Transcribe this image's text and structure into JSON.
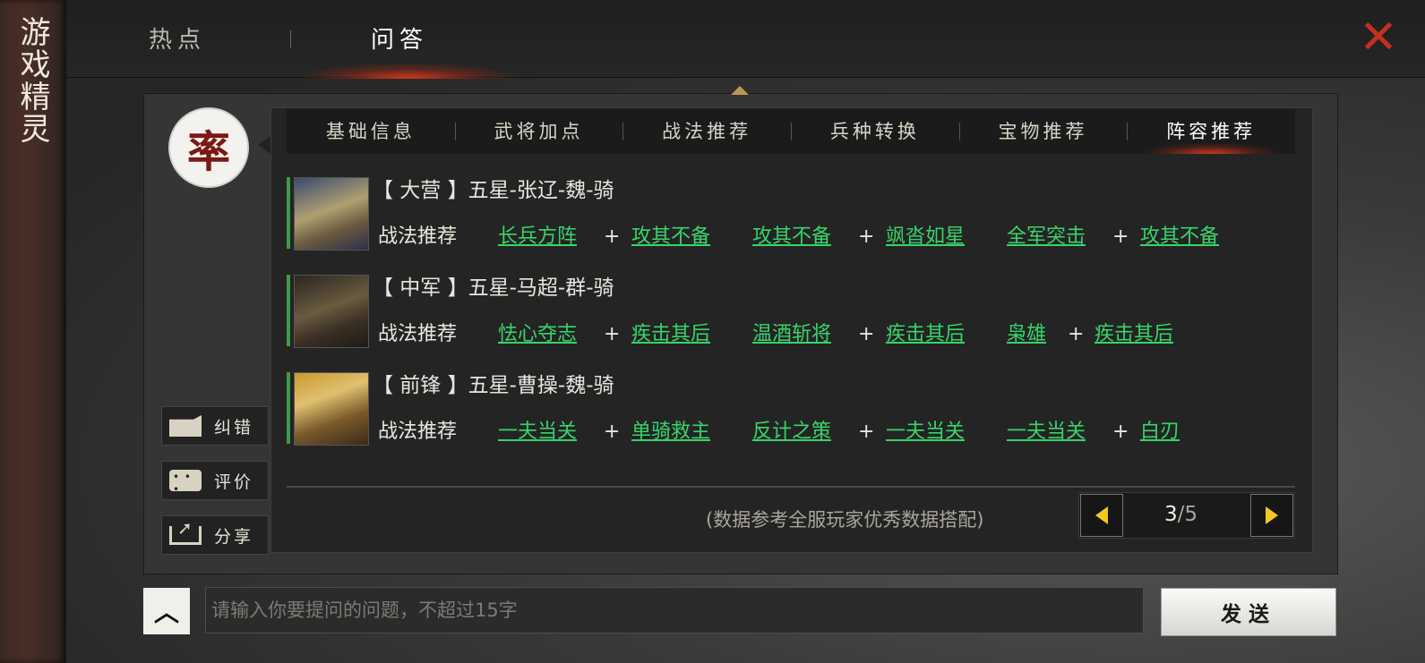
{
  "sidebar_title": "游戏精灵",
  "top_tabs": [
    {
      "label": "热点"
    },
    {
      "label": "问答"
    }
  ],
  "avatar_char": "率",
  "sub_tabs": [
    {
      "label": "基础信息"
    },
    {
      "label": "武将加点"
    },
    {
      "label": "战法推荐"
    },
    {
      "label": "兵种转换"
    },
    {
      "label": "宝物推荐"
    },
    {
      "label": "阵容推荐"
    }
  ],
  "tactic_label": "战法推荐",
  "rows": [
    {
      "role": "【 大营 】五星-张辽-魏-骑",
      "tactics": [
        "长兵方阵",
        "攻其不备",
        "攻其不备",
        "飒沓如星",
        "全军突击",
        "攻其不备"
      ]
    },
    {
      "role": "【 中军 】五星-马超-群-骑",
      "tactics": [
        "怯心夺志",
        "疾击其后",
        "温酒斩将",
        "疾击其后",
        "枭雄",
        "疾击其后"
      ]
    },
    {
      "role": "【 前锋 】五星-曹操-魏-骑",
      "tactics": [
        "一夫当关",
        "单骑救主",
        "反计之策",
        "一夫当关",
        "一夫当关",
        "白刃"
      ]
    }
  ],
  "plus_sign": "+",
  "note": "(数据参考全服玩家优秀数据搭配)",
  "pager": {
    "current": "3",
    "total": "/5"
  },
  "side_buttons": {
    "correct": "纠错",
    "rate": "评价",
    "share": "分享"
  },
  "input": {
    "placeholder": "请输入你要提问的问题，不超过15字",
    "value": ""
  },
  "send_label": "发送",
  "colors": {
    "accent_red": "#c2301f",
    "link_green": "#38d46a",
    "pager_yellow": "#f2c91c"
  }
}
